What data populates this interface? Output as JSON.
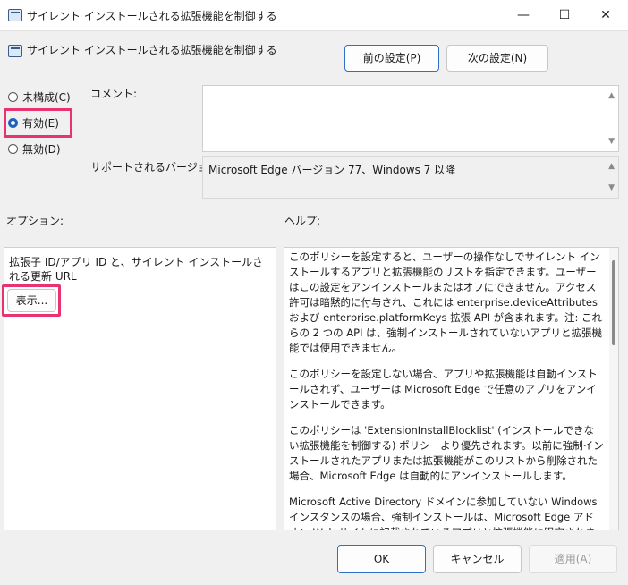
{
  "window": {
    "title": "サイレント インストールされる拡張機能を制御する",
    "controls": [
      "—",
      "☐",
      "✕"
    ]
  },
  "header": {
    "policy_title": "サイレント インストールされる拡張機能を制御する",
    "prev_button": "前の設定(P)",
    "next_button": "次の設定(N)"
  },
  "state": {
    "options": [
      {
        "label": "未構成(C)",
        "checked": false
      },
      {
        "label": "有効(E)",
        "checked": true
      },
      {
        "label": "無効(D)",
        "checked": false
      }
    ]
  },
  "comment": {
    "label": "コメント:",
    "value": ""
  },
  "supported": {
    "label": "サポートされるバージョン:",
    "value": "Microsoft Edge バージョン 77、Windows 7 以降"
  },
  "options_panel": {
    "heading": "オプション:",
    "item_label": "拡張子 ID/アプリ ID と、サイレント インストールされる更新 URL",
    "show_button": "表示..."
  },
  "help_panel": {
    "heading": "ヘルプ:",
    "paragraphs": [
      "このポリシーを設定すると、ユーザーの操作なしでサイレント インストールするアプリと拡張機能のリストを指定できます。ユーザーはこの設定をアンインストールまたはオフにできません。アクセス許可は暗黙的に付与され、これには enterprise.deviceAttributes および enterprise.platformKeys 拡張 API が含まれます。注: これらの 2 つの API は、強制インストールされていないアプリと拡張機能では使用できません。",
      "このポリシーを設定しない場合、アプリや拡張機能は自動インストールされず、ユーザーは Microsoft Edge で任意のアプリをアンインストールできます。",
      "このポリシーは 'ExtensionInstallBlocklist' (インストールできない拡張機能を制御する) ポリシーより優先されます。以前に強制インストールされたアプリまたは拡張機能がこのリストから削除された場合、Microsoft Edge は自動的にアンインストールします。",
      "Microsoft Active Directory ドメインに参加していない Windows インスタンスの場合、強制インストールは、Microsoft Edge アドオン Web サイトに記載されているアプリと拡張機能に限定されます。"
    ]
  },
  "footer": {
    "ok_button": "OK",
    "cancel_button": "キャンセル",
    "apply_button": "適用(A)"
  },
  "colors": {
    "highlight": "#e8336f",
    "accent": "#1f5fbf"
  }
}
